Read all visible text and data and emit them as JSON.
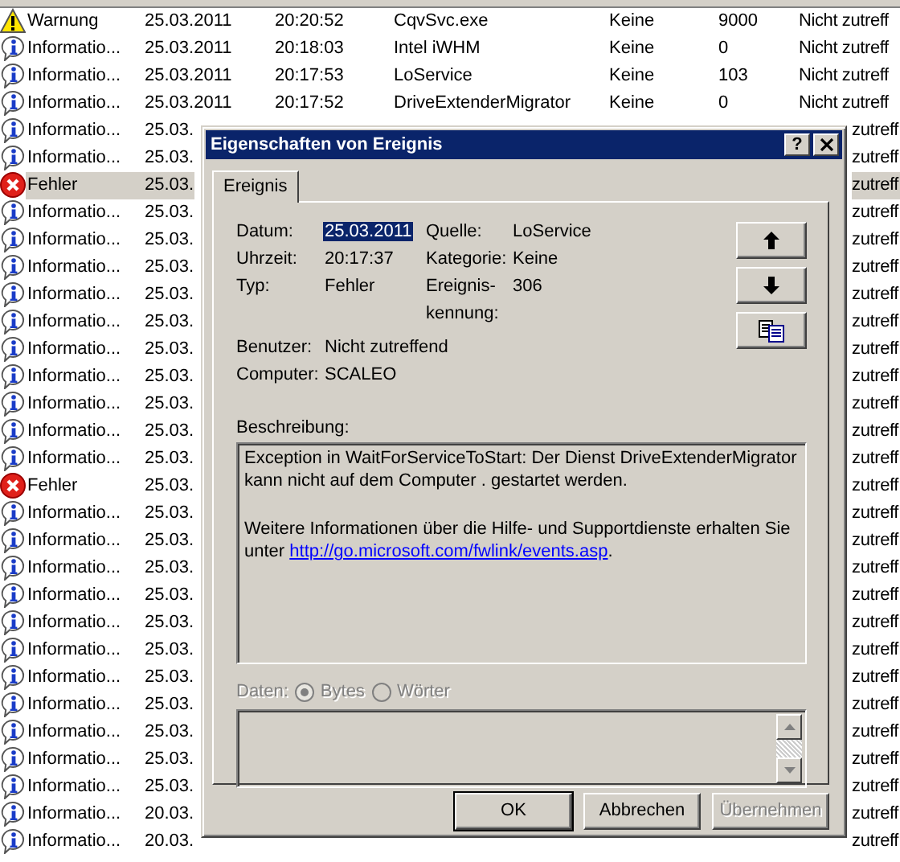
{
  "event_list": {
    "rows": [
      {
        "kind": "warning",
        "type": "Warnung",
        "selected": false,
        "date": "25.03.2011",
        "time": "20:20:52",
        "source": "CqvSvc.exe",
        "category": "Keine",
        "event": "9000",
        "user": "Nicht zutreff"
      },
      {
        "kind": "info",
        "type": "Informatio...",
        "selected": false,
        "date": "25.03.2011",
        "time": "20:18:03",
        "source": "Intel iWHM",
        "category": "Keine",
        "event": "0",
        "user": "Nicht zutreff"
      },
      {
        "kind": "info",
        "type": "Informatio...",
        "selected": false,
        "date": "25.03.2011",
        "time": "20:17:53",
        "source": "LoService",
        "category": "Keine",
        "event": "103",
        "user": "Nicht zutreff"
      },
      {
        "kind": "info",
        "type": "Informatio...",
        "selected": false,
        "date": "25.03.2011",
        "time": "20:17:52",
        "source": "DriveExtenderMigrator",
        "category": "Keine",
        "event": "0",
        "user": "Nicht zutreff"
      },
      {
        "kind": "info",
        "type": "Informatio...",
        "selected": false,
        "date": "25.03.",
        "user": "zutreff"
      },
      {
        "kind": "info",
        "type": "Informatio...",
        "selected": false,
        "date": "25.03.",
        "user": "zutreff"
      },
      {
        "kind": "error",
        "type": "Fehler",
        "selected": true,
        "date": "25.03.",
        "user": "zutreff"
      },
      {
        "kind": "info",
        "type": "Informatio...",
        "selected": false,
        "date": "25.03.",
        "user": "zutreff"
      },
      {
        "kind": "info",
        "type": "Informatio...",
        "selected": false,
        "date": "25.03.",
        "user": "zutreff"
      },
      {
        "kind": "info",
        "type": "Informatio...",
        "selected": false,
        "date": "25.03.",
        "user": "zutreff"
      },
      {
        "kind": "info",
        "type": "Informatio...",
        "selected": false,
        "date": "25.03.",
        "user": "zutreff"
      },
      {
        "kind": "info",
        "type": "Informatio...",
        "selected": false,
        "date": "25.03.",
        "user": "zutreff"
      },
      {
        "kind": "info",
        "type": "Informatio...",
        "selected": false,
        "date": "25.03.",
        "user": "zutreff"
      },
      {
        "kind": "info",
        "type": "Informatio...",
        "selected": false,
        "date": "25.03.",
        "user": "zutreff"
      },
      {
        "kind": "info",
        "type": "Informatio...",
        "selected": false,
        "date": "25.03.",
        "user": "zutreff"
      },
      {
        "kind": "info",
        "type": "Informatio...",
        "selected": false,
        "date": "25.03.",
        "user": "zutreff"
      },
      {
        "kind": "info",
        "type": "Informatio...",
        "selected": false,
        "date": "25.03.",
        "user": "zutreff"
      },
      {
        "kind": "error",
        "type": "Fehler",
        "selected": false,
        "date": "25.03.",
        "user": "zutreff"
      },
      {
        "kind": "info",
        "type": "Informatio...",
        "selected": false,
        "date": "25.03.",
        "user": "zutreff"
      },
      {
        "kind": "info",
        "type": "Informatio...",
        "selected": false,
        "date": "25.03.",
        "user": "zutreff"
      },
      {
        "kind": "info",
        "type": "Informatio...",
        "selected": false,
        "date": "25.03.",
        "user": "zutreff"
      },
      {
        "kind": "info",
        "type": "Informatio...",
        "selected": false,
        "date": "25.03.",
        "user": "zutreff"
      },
      {
        "kind": "info",
        "type": "Informatio...",
        "selected": false,
        "date": "25.03.",
        "user": "zutreff"
      },
      {
        "kind": "info",
        "type": "Informatio...",
        "selected": false,
        "date": "25.03.",
        "user": "zutreff"
      },
      {
        "kind": "info",
        "type": "Informatio...",
        "selected": false,
        "date": "25.03.",
        "user": "zutreff"
      },
      {
        "kind": "info",
        "type": "Informatio...",
        "selected": false,
        "date": "25.03.",
        "user": "zutreff"
      },
      {
        "kind": "info",
        "type": "Informatio...",
        "selected": false,
        "date": "25.03.",
        "user": "zutreff"
      },
      {
        "kind": "info",
        "type": "Informatio...",
        "selected": false,
        "date": "25.03.",
        "user": "zutreff"
      },
      {
        "kind": "info",
        "type": "Informatio...",
        "selected": false,
        "date": "25.03.",
        "user": "zutreff"
      },
      {
        "kind": "info",
        "type": "Informatio...",
        "selected": false,
        "date": "20.03.",
        "user": "zutreff"
      },
      {
        "kind": "info",
        "type": "Informatio...",
        "selected": false,
        "date": "20.03.",
        "user": "zutreff"
      }
    ]
  },
  "dialog": {
    "title": "Eigenschaften von Ereignis",
    "help_button": "?",
    "tabs": [
      {
        "label": "Ereignis",
        "selected": true
      }
    ],
    "fields_left": [
      {
        "label": "Datum:",
        "value": "25.03.2011",
        "selected": true
      },
      {
        "label": "Uhrzeit:",
        "value": "20:17:37",
        "selected": false
      },
      {
        "label": "Typ:",
        "value": "Fehler",
        "selected": false
      }
    ],
    "fields_right": [
      {
        "label": "Quelle:",
        "value": "LoService"
      },
      {
        "label": "Kategorie:",
        "value": "Keine"
      },
      {
        "label": "Ereignis-kennung:",
        "value": "306"
      }
    ],
    "fields_bottom": [
      {
        "label": "Benutzer:",
        "value": "Nicht zutreffend"
      },
      {
        "label": "Computer:",
        "value": "SCALEO"
      }
    ],
    "description_label": "Beschreibung:",
    "description": {
      "paragraph_1": "Exception in WaitForServiceToStart: Der Dienst DriveExtenderMigrator kann nicht auf dem Computer . gestartet werden.",
      "paragraph_2": "Weitere Informationen über die Hilfe- und Supportdienste erhalten Sie unter",
      "link": "http://go.microsoft.com/fwlink/events.asp",
      "after_link": "."
    },
    "data": {
      "label": "Daten:",
      "disabled": true,
      "options": [
        {
          "label": "Bytes",
          "selected": true
        },
        {
          "label": "Wörter",
          "selected": false
        }
      ]
    },
    "buttons": [
      {
        "label": "OK",
        "default": true,
        "disabled": false
      },
      {
        "label": "Abbrechen",
        "default": false,
        "disabled": false
      },
      {
        "label": "Übernehmen",
        "default": false,
        "disabled": true
      }
    ]
  }
}
